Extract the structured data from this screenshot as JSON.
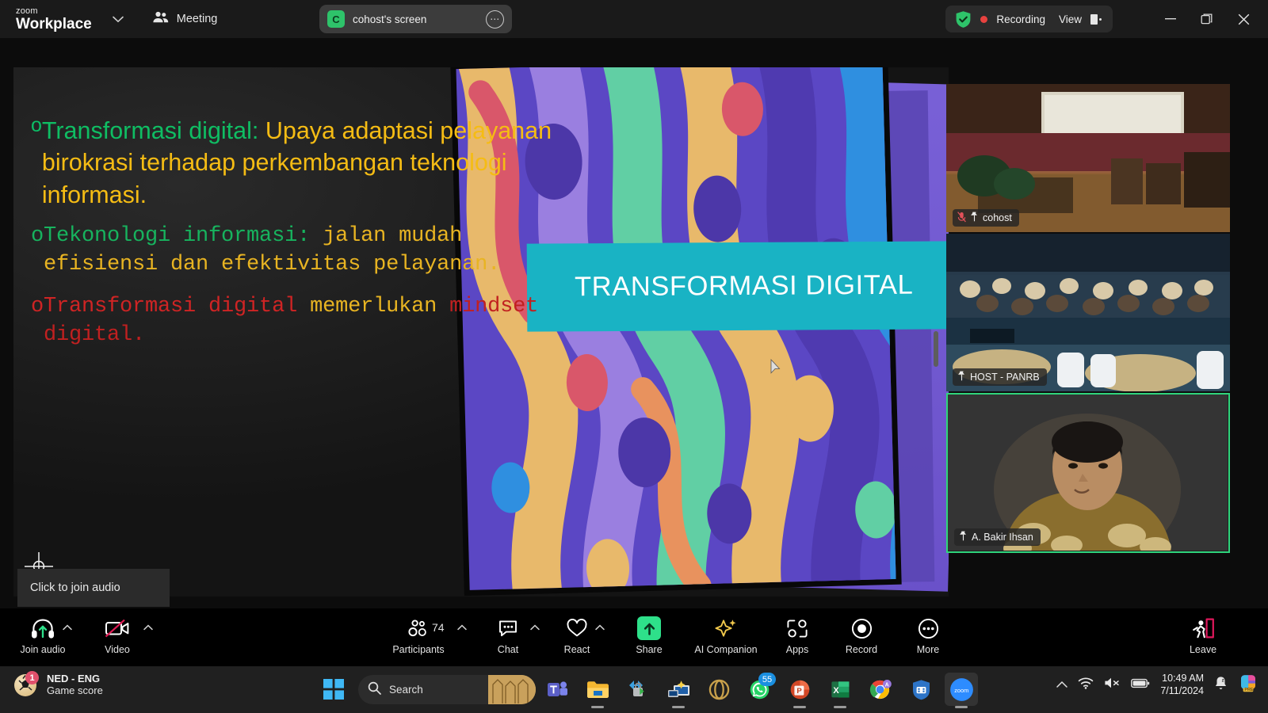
{
  "titlebar": {
    "brand_line1": "zoom",
    "brand_line2": "Workplace",
    "brand_caret": "chevron-down",
    "meeting_label": "Meeting",
    "share_chip": {
      "avatar_letter": "C",
      "name": "cohost's screen",
      "more_label": "⋯"
    },
    "recording_label": "Recording",
    "view_label": "View",
    "window_minimize": "—",
    "window_restore": "❐",
    "window_close": "✕"
  },
  "slide": {
    "banner_title": "TRANSFORMASI DIGITAL",
    "bullet1": {
      "marker": "o",
      "green": "Transformasi digital:",
      "yellow": " Upaya adaptasi pelayanan birokrasi terhadap perkembangan teknologi informasi."
    },
    "bullet2": {
      "marker": "o",
      "green": "Tekonologi informasi:",
      "yellow": " jalan mudah efisiensi dan efektivitas pelayanan."
    },
    "bullet3": {
      "marker": "o",
      "red": "Transformasi digital",
      "yellow": " memerlukan",
      "red2": " mindset digital."
    }
  },
  "tooltip": {
    "text": "Click to join audio"
  },
  "thumbnails": [
    {
      "name": "cohost",
      "muted": true,
      "pinned": true,
      "speaking": false
    },
    {
      "name": "HOST - PANRB",
      "muted": false,
      "pinned": true,
      "speaking": true
    },
    {
      "name": "A. Bakir Ihsan",
      "muted": false,
      "pinned": true,
      "speaking": true
    }
  ],
  "controls": {
    "join_audio": {
      "label": "Join audio",
      "icon": "headset-join-icon",
      "has_caret": true
    },
    "video": {
      "label": "Video",
      "icon": "video-off-icon",
      "has_caret": true
    },
    "participants": {
      "label": "Participants",
      "icon": "participants-icon",
      "count": "74",
      "has_caret": false
    },
    "chat": {
      "label": "Chat",
      "icon": "chat-bubble-icon",
      "has_caret": true
    },
    "react": {
      "label": "React",
      "icon": "heart-icon",
      "has_caret": true
    },
    "share": {
      "label": "Share",
      "icon": "share-up-arrow-icon"
    },
    "ai_companion": {
      "label": "AI Companion",
      "icon": "sparkle-icon"
    },
    "apps": {
      "label": "Apps",
      "icon": "apps-icon"
    },
    "record": {
      "label": "Record",
      "icon": "record-circle-icon"
    },
    "more": {
      "label": "More",
      "icon": "ellipsis-icon"
    },
    "leave": {
      "label": "Leave",
      "icon": "leave-door-icon"
    }
  },
  "taskbar": {
    "widget": {
      "title": "NED - ENG",
      "subtitle": "Game score",
      "badge": "1",
      "icon": "soccer-ball-icon"
    },
    "start_icon": "windows-start-icon",
    "search": {
      "placeholder": "Search",
      "icon": "search-icon"
    },
    "apps": [
      {
        "name": "teams-icon",
        "badge": ""
      },
      {
        "name": "file-explorer-icon",
        "badge": ""
      },
      {
        "name": "remote-lock-icon",
        "badge": ""
      },
      {
        "name": "remote-desktop-icon",
        "badge": ""
      },
      {
        "name": "opera-icon",
        "badge": ""
      },
      {
        "name": "whatsapp-icon",
        "badge": "55"
      },
      {
        "name": "powerpoint-icon",
        "badge": ""
      },
      {
        "name": "excel-icon",
        "badge": ""
      },
      {
        "name": "chrome-icon",
        "badge": ""
      },
      {
        "name": "security-icon",
        "badge": ""
      },
      {
        "name": "zoom-icon",
        "badge": ""
      }
    ],
    "tray": {
      "chevron": "show-hidden-icons",
      "wifi": "wifi-icon",
      "volume": "volume-muted-icon",
      "battery": "battery-icon",
      "time": "10:49 AM",
      "date": "7/11/2024",
      "notification": "notifications-silent-icon",
      "copilot": "copilot-icon"
    }
  },
  "colors": {
    "zoom_green": "#2ee08a",
    "recording_red": "#e8423f",
    "teal_banner": "#19b3c4",
    "speaking_green": "#2fd47c",
    "slide_green": "#0fbd63",
    "slide_yellow": "#f5bc14",
    "slide_red": "#cf2424"
  }
}
